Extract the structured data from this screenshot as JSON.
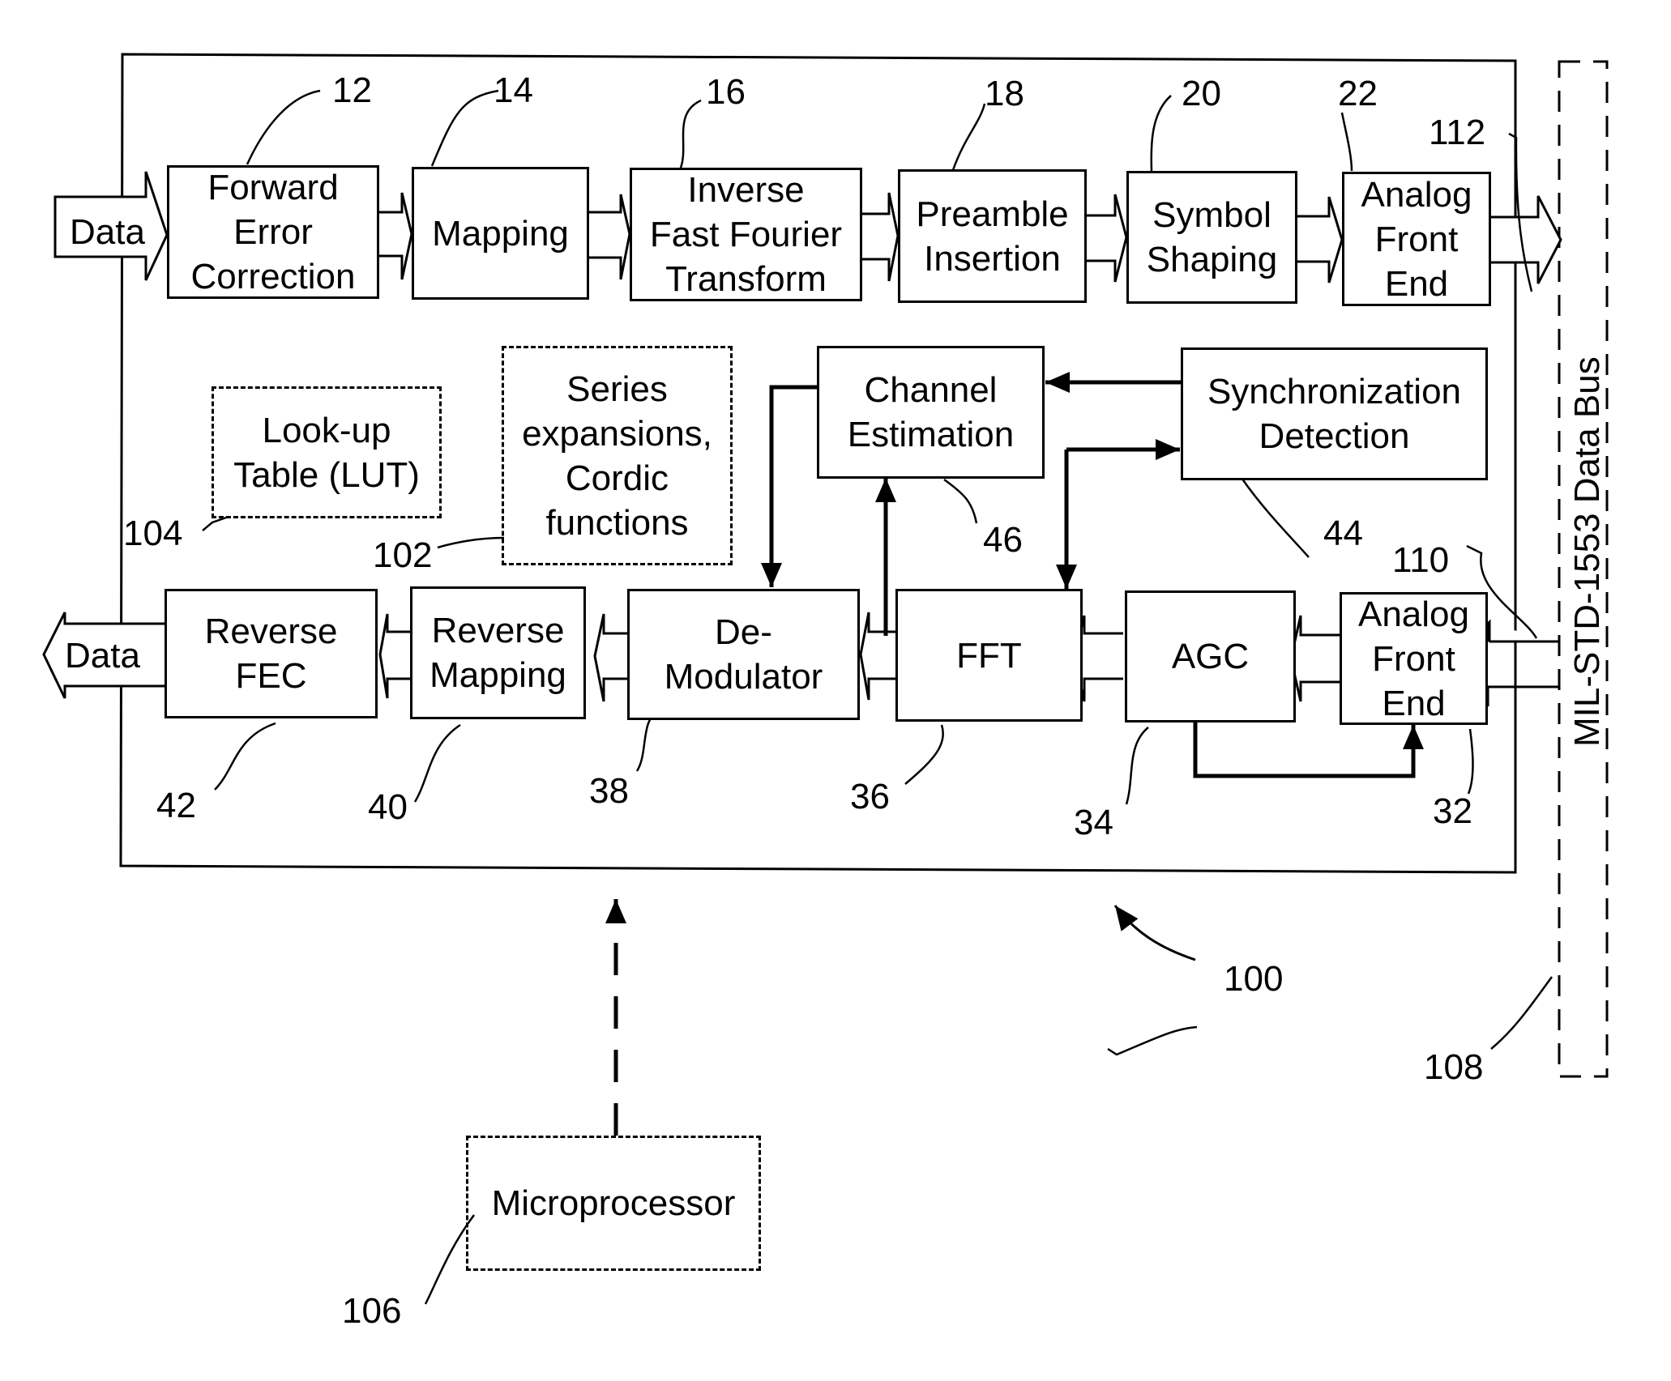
{
  "figure": {
    "system_ref": "100",
    "bus": {
      "label": "MIL-STD-1553 Data Bus",
      "ref": "108"
    },
    "tx_bus_link_ref": "112",
    "rx_bus_link_ref": "110",
    "input_label": "Data",
    "output_label": "Data",
    "transmit_chain": [
      {
        "label": "Forward\nError\nCorrection",
        "ref": "12"
      },
      {
        "label": "Mapping",
        "ref": "14"
      },
      {
        "label": "Inverse\nFast Fourier\nTransform",
        "ref": "16"
      },
      {
        "label": "Preamble\nInsertion",
        "ref": "18"
      },
      {
        "label": "Symbol\nShaping",
        "ref": "20"
      },
      {
        "label": "Analog\nFront\nEnd",
        "ref": "22"
      }
    ],
    "receive_chain": [
      {
        "label": "Reverse\nFEC",
        "ref": "42"
      },
      {
        "label": "Reverse\nMapping",
        "ref": "40"
      },
      {
        "label": "De-\nModulator",
        "ref": "38"
      },
      {
        "label": "FFT",
        "ref": "36"
      },
      {
        "label": "AGC",
        "ref": "34"
      },
      {
        "label": "Analog\nFront\nEnd",
        "ref": "32"
      }
    ],
    "channel_estimation": {
      "label": "Channel\nEstimation",
      "ref": "46"
    },
    "sync_detection": {
      "label": "Synchronization\nDetection",
      "ref": "44"
    },
    "lut": {
      "label": "Look-up\nTable (LUT)",
      "ref": "104"
    },
    "series": {
      "label": "Series\nexpansions,\nCordic\nfunctions",
      "ref": "102"
    },
    "microprocessor": {
      "label": "Microprocessor",
      "ref": "106"
    }
  }
}
